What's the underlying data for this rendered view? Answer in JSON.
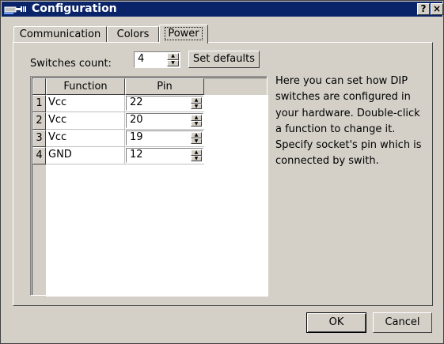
{
  "window": {
    "title": "Configuration",
    "help_button": "?",
    "close_button": "×"
  },
  "tabs": [
    {
      "label": "Communication",
      "selected": false
    },
    {
      "label": "Colors",
      "selected": false
    },
    {
      "label": "Power",
      "selected": true
    }
  ],
  "power": {
    "switches_count_label": "Switches count:",
    "switches_count_value": "4",
    "set_defaults_label": "Set defaults",
    "table": {
      "columns": [
        "Function",
        "Pin"
      ],
      "rows": [
        {
          "num": "1",
          "function": "Vcc",
          "pin": "22"
        },
        {
          "num": "2",
          "function": "Vcc",
          "pin": "20"
        },
        {
          "num": "3",
          "function": "Vcc",
          "pin": "19"
        },
        {
          "num": "4",
          "function": "GND",
          "pin": "12"
        }
      ]
    },
    "help_text": "Here you can set how DIP switches are configured in your hardware. Double-click a function to change it. Specify socket's pin which is connected by swith."
  },
  "footer": {
    "ok_label": "OK",
    "cancel_label": "Cancel"
  },
  "colors": {
    "titlebar": "#0a246a",
    "face": "#d4d0c8"
  }
}
